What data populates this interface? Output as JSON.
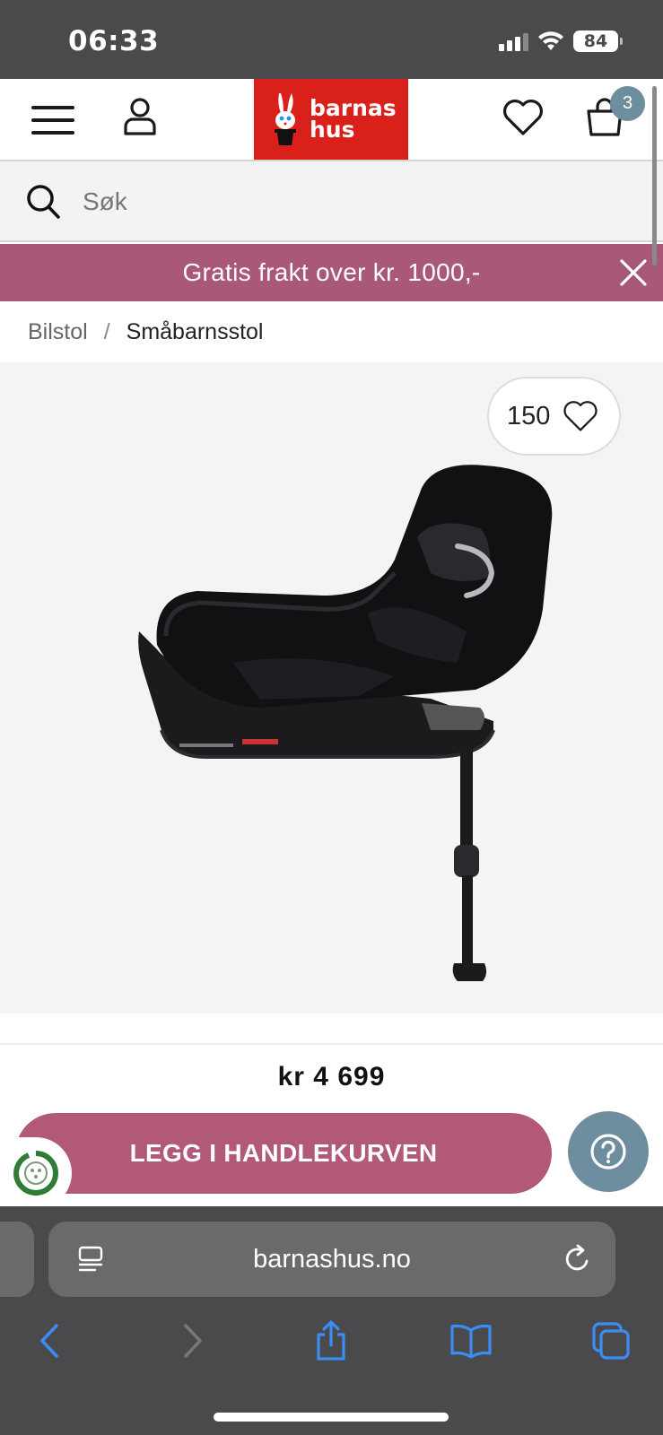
{
  "status_bar": {
    "time": "06:33",
    "battery": "84",
    "icons": [
      "signal-icon",
      "wifi-icon",
      "battery-icon"
    ]
  },
  "header": {
    "logo_text_line1": "barnas",
    "logo_text_line2": "hus",
    "cart_count": "3",
    "icons": [
      "menu-icon",
      "user-icon",
      "heart-icon",
      "cart-icon"
    ],
    "logo_color": "#d9201b",
    "badge_color": "#6e8ea0"
  },
  "search": {
    "placeholder": "Søk"
  },
  "promo": {
    "text": "Gratis frakt over kr. 1000,-",
    "color": "#a9587a"
  },
  "breadcrumb": {
    "items": [
      "Bilstol",
      "Småbarnsstol"
    ],
    "separator": "/"
  },
  "product": {
    "favorite_count": "150",
    "price": "kr 4 699",
    "add_to_cart_label": "LEGG I HANDLEKURVEN",
    "button_color": "#b25879"
  },
  "browser": {
    "url": "barnashus.no",
    "icons": [
      "reader-icon",
      "reload-icon",
      "back-icon",
      "forward-icon",
      "share-icon",
      "bookmarks-icon",
      "tabs-icon"
    ]
  }
}
